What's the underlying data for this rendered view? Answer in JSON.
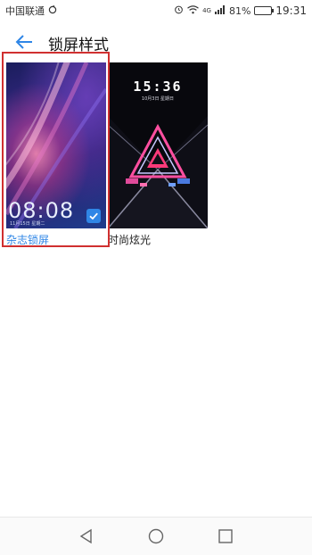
{
  "status_bar": {
    "carrier": "中国联通",
    "network": "4G",
    "battery": "81%",
    "battery_level": 0.81,
    "time": "19:31"
  },
  "header": {
    "title": "锁屏样式"
  },
  "styles": [
    {
      "label": "杂志锁屏",
      "selected": true,
      "preview_time": "08:08",
      "preview_date": "11月15日  星期二"
    },
    {
      "label": "时尚炫光",
      "selected": false,
      "preview_time": "15:36",
      "preview_date": "10月3日 星期日"
    }
  ],
  "colors": {
    "accent": "#2f86e6",
    "selection_outline": "#d03030"
  },
  "icons": {
    "back": "back-arrow-icon",
    "nav_back": "nav-back-icon",
    "nav_home": "nav-home-icon",
    "nav_recent": "nav-recent-icon"
  }
}
